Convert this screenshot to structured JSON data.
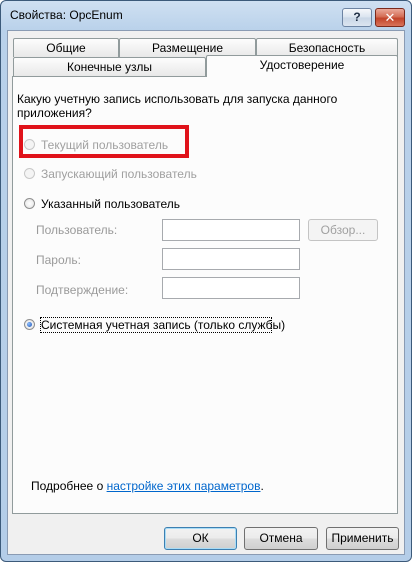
{
  "window": {
    "title": "Свойства: OpcEnum",
    "help_glyph": "?",
    "close_glyph": "✕"
  },
  "tabs": {
    "back_row": [
      "Общие",
      "Размещение",
      "Безопасность"
    ],
    "front_row": [
      "Конечные узлы",
      "Удостоверение"
    ],
    "active": "Удостоверение"
  },
  "panel": {
    "question": "Какую учетную запись использовать для запуска данного приложения?",
    "options": [
      {
        "label": "Текущий пользователь",
        "enabled": false,
        "selected": false
      },
      {
        "label": "Запускающий пользователь",
        "enabled": false,
        "selected": false
      },
      {
        "label": "Указанный пользователь",
        "enabled": true,
        "selected": false
      },
      {
        "label": "Системная учетная запись (только службы)",
        "enabled": true,
        "selected": true
      }
    ],
    "user_label": "Пользователь:",
    "user_value": "",
    "password_label": "Пароль:",
    "password_value": "",
    "confirm_label": "Подтверждение:",
    "confirm_value": "",
    "browse_label": "Обзор...",
    "more_prefix": "Подробнее о ",
    "more_link": "настройке этих параметров",
    "more_suffix": "."
  },
  "buttons": {
    "ok": "ОК",
    "cancel": "Отмена",
    "apply": "Применить"
  },
  "colors": {
    "highlight": "#e0121a",
    "link": "#0066cc",
    "window_frame": "#b9d1ea"
  }
}
